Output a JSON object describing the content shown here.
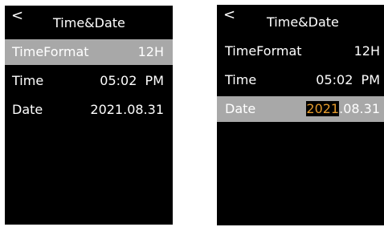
{
  "colors": {
    "screen_bg": "#000000",
    "text": "#ffffff",
    "selected_row": "#a8a8a8",
    "edit_highlight": "#e49a2c"
  },
  "left_screen": {
    "back_icon": "chevron-left-icon",
    "back_glyph": "<",
    "title": "Time&Date",
    "rows": [
      {
        "label": "TimeFormat",
        "value": "12H",
        "selected": true
      },
      {
        "label": "Time",
        "value": "05:02  PM",
        "selected": false
      },
      {
        "label": "Date",
        "value": "2021.08.31",
        "selected": false
      }
    ]
  },
  "right_screen": {
    "back_icon": "chevron-left-icon",
    "back_glyph": "<",
    "title": "Time&Date",
    "rows": [
      {
        "label": "TimeFormat",
        "value": "12H",
        "selected": false
      },
      {
        "label": "Time",
        "value": "05:02  PM",
        "selected": false
      },
      {
        "label": "Date",
        "value_editing": "2021",
        "value_rest": ".08.31",
        "selected": true
      }
    ]
  }
}
